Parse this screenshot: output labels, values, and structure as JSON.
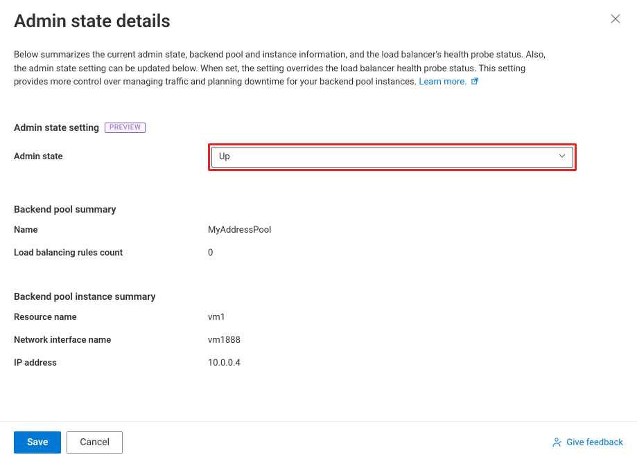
{
  "header": {
    "title": "Admin state details"
  },
  "description": {
    "text": "Below summarizes the current admin state, backend pool and instance information, and the load balancer's health probe status. Also, the admin state setting can be updated below. When set, the setting overrides the load balancer health probe status. This setting provides more control over managing traffic and planning downtime for your backend pool instances.",
    "learn_more_label": "Learn more."
  },
  "admin_state_section": {
    "heading": "Admin state setting",
    "badge": "PREVIEW",
    "field_label": "Admin state",
    "selected_value": "Up"
  },
  "backend_pool_summary": {
    "heading": "Backend pool summary",
    "rows": {
      "name_label": "Name",
      "name_value": "MyAddressPool",
      "lb_rules_label": "Load balancing rules count",
      "lb_rules_value": "0"
    }
  },
  "backend_instance_summary": {
    "heading": "Backend pool instance summary",
    "rows": {
      "resource_name_label": "Resource name",
      "resource_name_value": "vm1",
      "nic_label": "Network interface name",
      "nic_value": "vm1888",
      "ip_label": "IP address",
      "ip_value": "10.0.0.4"
    }
  },
  "footer": {
    "save_label": "Save",
    "cancel_label": "Cancel",
    "feedback_label": "Give feedback"
  }
}
